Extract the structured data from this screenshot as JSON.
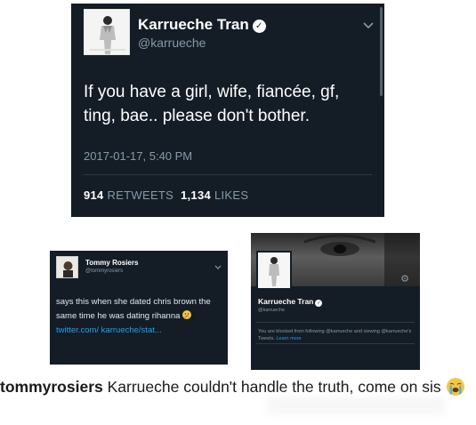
{
  "main_tweet": {
    "name": "Karrueche Tran",
    "handle": "@karrueche",
    "text": "If you have a girl, wife, fiancée, gf, ting, bae.. please don't bother.",
    "timestamp": "2017-01-17, 5:40 PM",
    "retweets_count": "914",
    "retweets_label": "RETWEETS",
    "likes_count": "1,134",
    "likes_label": "LIKES",
    "icons": {
      "verified": "verified-icon",
      "menu": "chevron-down-icon"
    }
  },
  "small_tweet": {
    "name": "Tommy Rosiers",
    "handle": "@tommyrosiers",
    "text": "says this when she dated chris brown the same time he was dating rihanna",
    "emoji": "thinking-face-emoji",
    "link": "twitter.com/ karrueche/stat...",
    "icons": {
      "menu": "chevron-down-icon"
    }
  },
  "profile_card": {
    "name": "Karrueche Tran",
    "handle": "@karrueche",
    "blocked_text": "You are blocked from following @karrueche and viewing @karrueche's Tweets.",
    "learn_more": "Learn more",
    "icons": {
      "settings": "gear-icon",
      "verified": "verified-icon"
    }
  },
  "caption": {
    "username": "tommyrosiers",
    "text": "Karrueche couldn't handle the truth, come on sis",
    "emoji": "loudly-crying-face-emoji"
  },
  "colors": {
    "card_background": "#141d26",
    "secondary_text": "#8899a6",
    "link": "#1da1f2"
  }
}
